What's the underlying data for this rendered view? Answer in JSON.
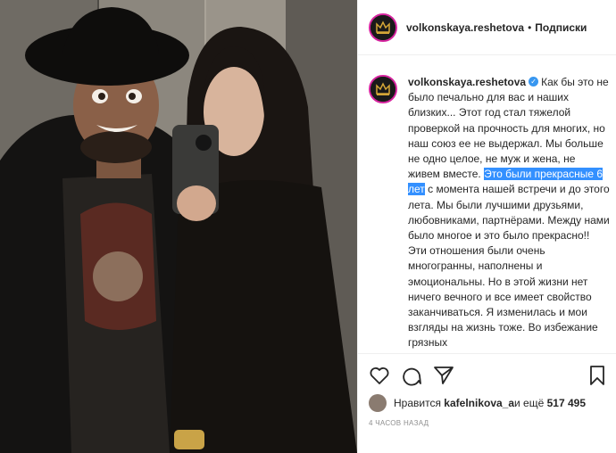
{
  "header": {
    "username": "volkonskaya.reshetova",
    "separator": "•",
    "follow_label": "Подписки"
  },
  "caption": {
    "username": "volkonskaya.reshetova",
    "verified_mark": "✓",
    "text_before": "Как бы это не было печально для вас и наших близких... Этот год стал тяжелой проверкой на прочность для многих, но наш союз ее не выдержал. Мы больше не одно целое, не муж и жена, не живем вместе. ",
    "text_highlight": "Это были прекрасные 6 лет",
    "text_after": " с момента нашей встречи и до этого лета. Мы были лучшими друзьями, любовниками, партнёрами. Между нами было многое и это было прекрасно!! Эти отношения были очень многогранны, наполнены и эмоциональны. Но в этой жизни нет ничего вечного и все имеет свойство заканчиваться. Я изменилась и мои взгляды на жизнь тоже. Во избежание грязных"
  },
  "likes": {
    "prefix": "Нравится ",
    "user": "kafelnikova_a",
    "middle": " и ещё ",
    "count": "517 495"
  },
  "timestamp": "4 ЧАСОВ НАЗАД",
  "icons": {
    "like": "heart-icon",
    "comment": "comment-icon",
    "share": "share-icon",
    "save": "bookmark-icon"
  },
  "colors": {
    "highlight": "#3390ff",
    "verified": "#3897f0",
    "avatar_ring": "#d6249f",
    "logo_gold": "#d4a637"
  }
}
